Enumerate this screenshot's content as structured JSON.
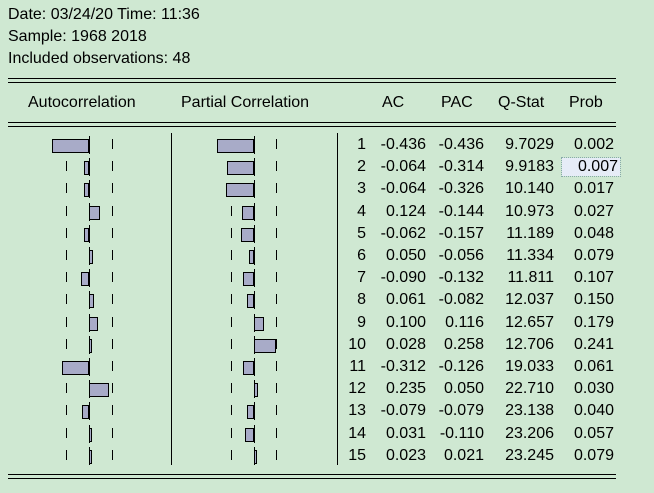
{
  "header": {
    "date_time": "Date: 03/24/20   Time: 11:36",
    "sample": "Sample: 1968 2018",
    "observations": "Included observations: 48"
  },
  "columns": {
    "autocorrelation": "Autocorrelation",
    "partial_correlation": "Partial Correlation",
    "ac": "AC",
    "pac": "PAC",
    "qstat": "Q-Stat",
    "prob": "Prob"
  },
  "selected_cell": "row 2 Prob",
  "colors": {
    "background": "#cfe8d2",
    "bar_fill": "#a8abc8",
    "selection": "#e6ecf7"
  },
  "rows": [
    {
      "lag": "1",
      "ac": "-0.436",
      "pac": "-0.436",
      "qstat": "9.7029",
      "prob": "0.002"
    },
    {
      "lag": "2",
      "ac": "-0.064",
      "pac": "-0.314",
      "qstat": "9.9183",
      "prob": "0.007"
    },
    {
      "lag": "3",
      "ac": "-0.064",
      "pac": "-0.326",
      "qstat": "10.140",
      "prob": "0.017"
    },
    {
      "lag": "4",
      "ac": "0.124",
      "pac": "-0.144",
      "qstat": "10.973",
      "prob": "0.027"
    },
    {
      "lag": "5",
      "ac": "-0.062",
      "pac": "-0.157",
      "qstat": "11.189",
      "prob": "0.048"
    },
    {
      "lag": "6",
      "ac": "0.050",
      "pac": "-0.056",
      "qstat": "11.334",
      "prob": "0.079"
    },
    {
      "lag": "7",
      "ac": "-0.090",
      "pac": "-0.132",
      "qstat": "11.811",
      "prob": "0.107"
    },
    {
      "lag": "8",
      "ac": "0.061",
      "pac": "-0.082",
      "qstat": "12.037",
      "prob": "0.150"
    },
    {
      "lag": "9",
      "ac": "0.100",
      "pac": "0.116",
      "qstat": "12.657",
      "prob": "0.179"
    },
    {
      "lag": "10",
      "ac": "0.028",
      "pac": "0.258",
      "qstat": "12.706",
      "prob": "0.241"
    },
    {
      "lag": "11",
      "ac": "-0.312",
      "pac": "-0.126",
      "qstat": "19.033",
      "prob": "0.061"
    },
    {
      "lag": "12",
      "ac": "0.235",
      "pac": "0.050",
      "qstat": "22.710",
      "prob": "0.030"
    },
    {
      "lag": "13",
      "ac": "-0.079",
      "pac": "-0.079",
      "qstat": "23.138",
      "prob": "0.040"
    },
    {
      "lag": "14",
      "ac": "0.031",
      "pac": "-0.110",
      "qstat": "23.206",
      "prob": "0.057"
    },
    {
      "lag": "15",
      "ac": "0.023",
      "pac": "0.021",
      "qstat": "23.245",
      "prob": "0.079"
    }
  ]
}
